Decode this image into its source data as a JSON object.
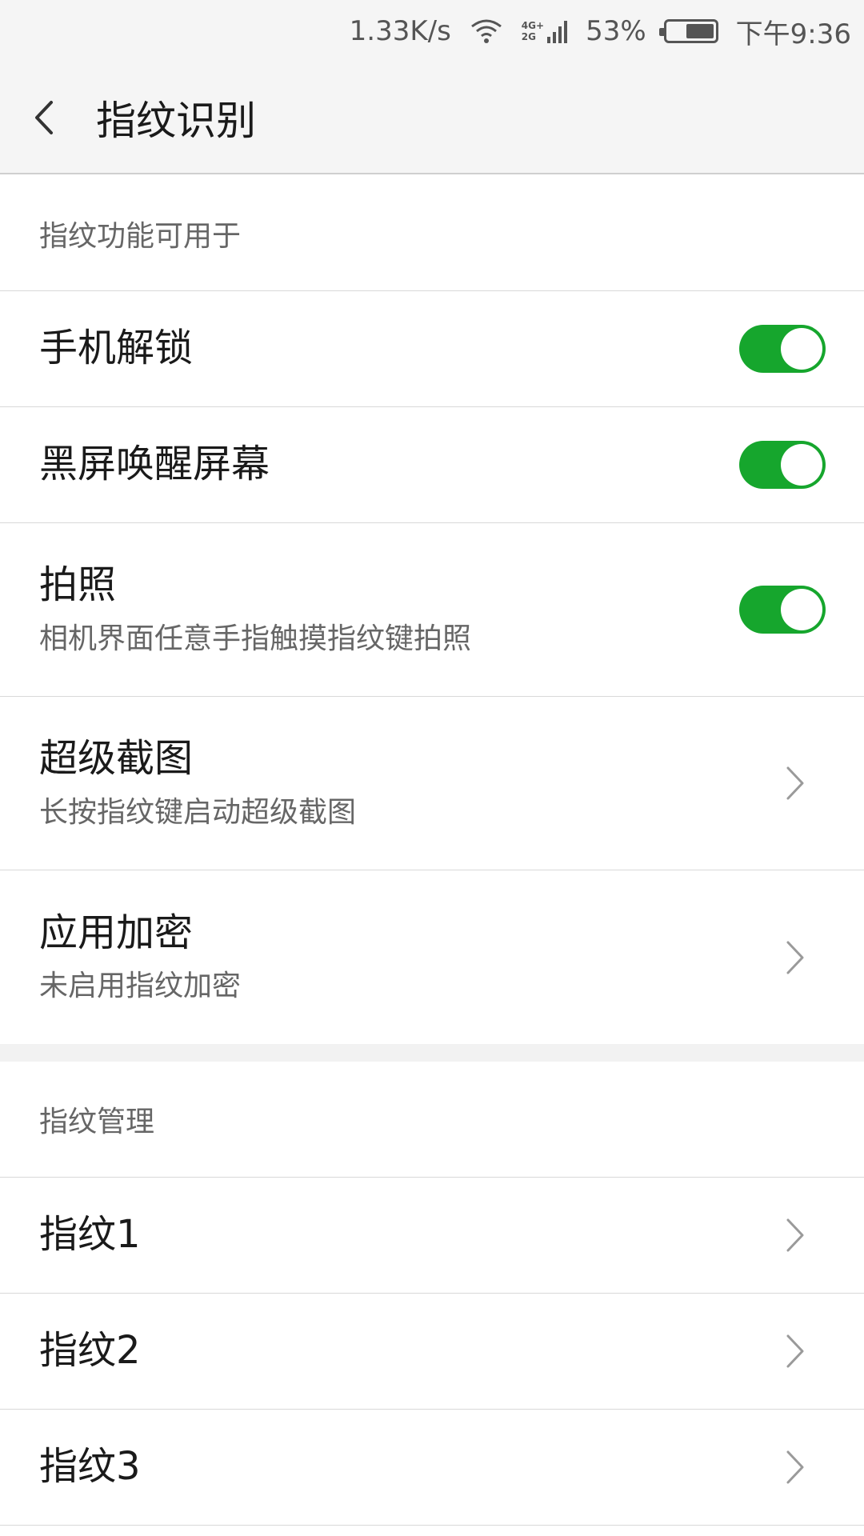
{
  "status_bar": {
    "speed": "1.33K/s",
    "net_top": "4G+",
    "net_bottom": "2G",
    "battery": "53%",
    "time": "下午9:36"
  },
  "header": {
    "title": "指纹识别"
  },
  "section1": {
    "label": "指纹功能可用于"
  },
  "rows": [
    {
      "title": "手机解锁",
      "toggle": true
    },
    {
      "title": "黑屏唤醒屏幕",
      "toggle": true
    },
    {
      "title": "拍照",
      "subtitle": "相机界面任意手指触摸指纹键拍照",
      "toggle": true
    },
    {
      "title": "超级截图",
      "subtitle": "长按指纹键启动超级截图"
    },
    {
      "title": "应用加密",
      "subtitle": "未启用指纹加密"
    }
  ],
  "section2": {
    "label": "指纹管理"
  },
  "fingerprints": [
    {
      "title": "指纹1"
    },
    {
      "title": "指纹2"
    },
    {
      "title": "指纹3"
    }
  ],
  "colors": {
    "toggle_on": "#16a62d",
    "background": "#f5f5f5"
  }
}
